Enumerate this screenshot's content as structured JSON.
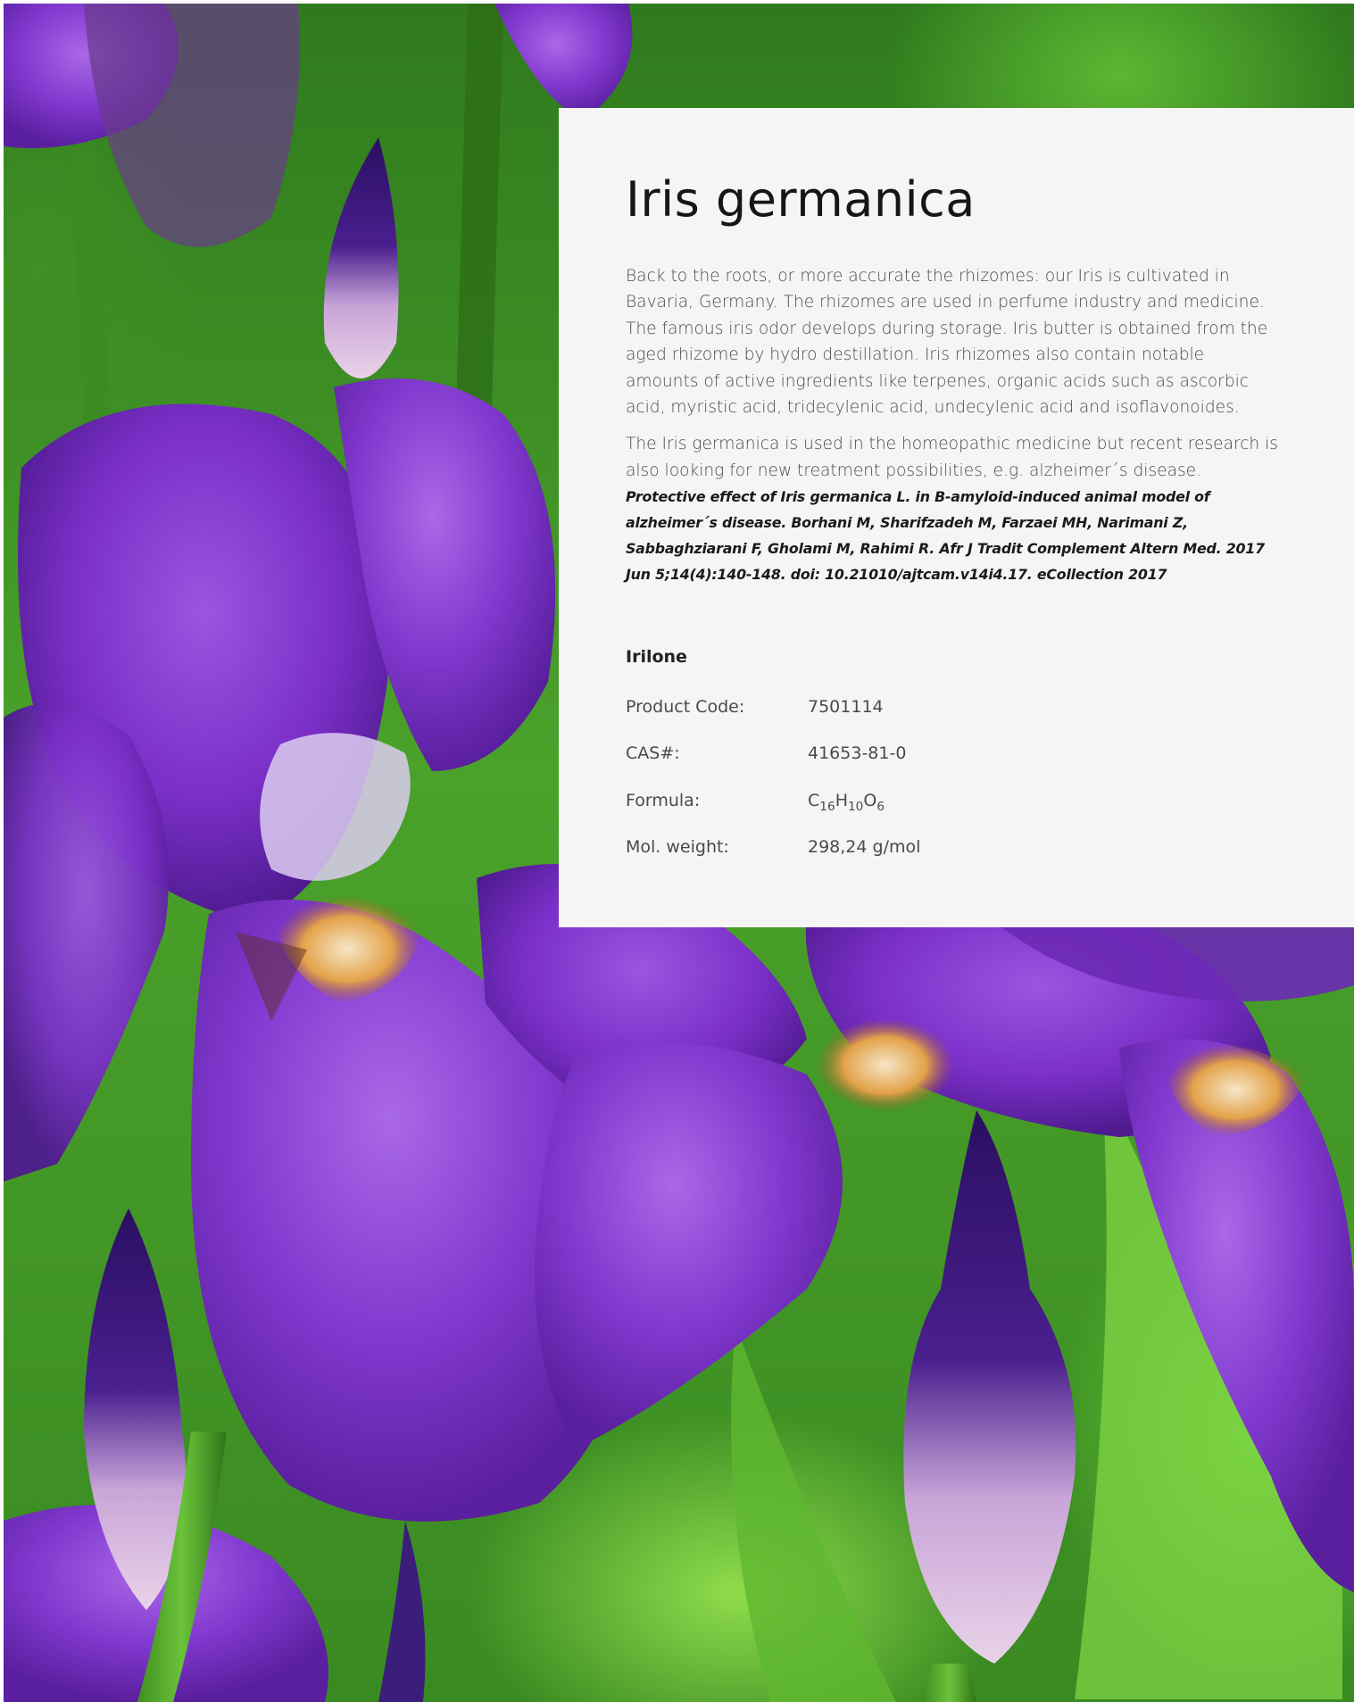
{
  "product": {
    "title": "Iris germanica",
    "paragraphs": [
      "Back to the roots, or more accurate the rhizomes: our Iris is cultivated in Bavaria, Germany. The rhizomes are used in perfume industry and medicine. The famous iris odor develops during storage. Iris butter is obtained from the aged rhizome by hydro destillation. Iris rhizomes also contain notable amounts of active ingredients like terpenes, organic acids such as ascorbic acid, myristic acid, tridecylenic acid, undecylenic acid and isoflavonoides.",
      "The Iris germanica is used in the homeopathic medicine but recent research is also looking for new treatment possibilities, e.g. alzheimer´s disease."
    ],
    "citation": "Protective effect of Iris germanica L. in B-amyloid-induced animal model of alzheimer´s disease. Borhani M, Sharifzadeh M, Farzaei MH, Narimani Z, Sabbaghziarani F, Gholami M, Rahimi R. Afr J Tradit Complement Altern Med. 2017 Jun 5;14(4):140-148. doi: 10.21010/ajtcam.v14i4.17. eCollection 2017"
  },
  "compound": {
    "name": "Irilone",
    "product_code_label": "Product Code:",
    "product_code": "7501114",
    "cas_label": "CAS#:",
    "cas": "41653-81-0",
    "formula_label": "Formula:",
    "formula": {
      "c": "C",
      "c_n": "16",
      "h": "H",
      "h_n": "10",
      "o": "O",
      "o_n": "6"
    },
    "mol_weight_label": "Mol. weight:",
    "mol_weight": "298,24 g/mol"
  },
  "colors": {
    "card_background": "#f5f5f5",
    "petal_purple": "#7a2fc8",
    "leaf_green": "#4aa22a"
  }
}
